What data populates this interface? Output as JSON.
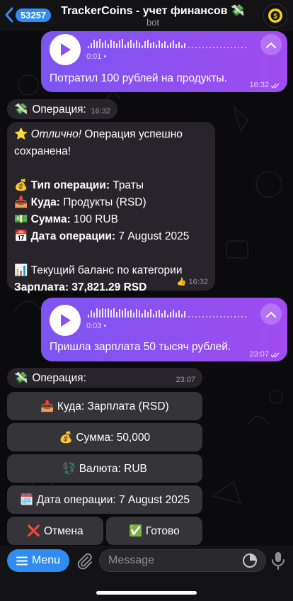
{
  "header": {
    "back_count": "53257",
    "title": "TrackerCoins - учет финансов 💸",
    "subtitle": "bot"
  },
  "messages": {
    "voice1": {
      "duration": "0:01",
      "transcript": "Потратил 100 рублей на продукты.",
      "time": "16:32"
    },
    "op1": {
      "label": "Операция:",
      "time": "16:32"
    },
    "result": {
      "line1_star": "⭐",
      "line1_em": "Отлично!",
      "line1_rest": " Операция успешно",
      "line2": "сохранена!",
      "type_icon": "💰",
      "type_key": "Тип операции:",
      "type_val": " Траты",
      "to_icon": "📥",
      "to_key": "Куда:",
      "to_val": " Продукты (RSD)",
      "sum_icon": "💵",
      "sum_key": "Сумма:",
      "sum_val": " 100 RUB",
      "date_icon": "📅",
      "date_key": "Дата операции:",
      "date_val": " 7 August 2025",
      "bal_icon": "📊",
      "bal_text": " Текущий баланс по категории",
      "bal_key": "Зарплата:",
      "bal_val": " 37,821.29 RSD",
      "stamp": "👍 16:32"
    },
    "voice2": {
      "duration": "0:03",
      "transcript": "Пришла зарплата 50 тысяч рублей.",
      "time": "23:07"
    },
    "op2": {
      "label": "Операция:",
      "time": "23:07"
    }
  },
  "keyboard": {
    "to": "📥 Куда: Зарплата (RSD)",
    "sum": "💰 Сумма: 50,000",
    "currency": "💱 Валюта: RUB",
    "date": "🗓️ Дата операции: 7 August 2025",
    "cancel": "❌ Отмена",
    "done": "✅ Готово"
  },
  "bottom": {
    "menu_label": "Menu",
    "placeholder": "Message"
  },
  "colors": {
    "accent": "#2f8cf0",
    "voice_gradient_start": "#7b55f2",
    "voice_gradient_end": "#a14cf0"
  },
  "icons": [
    "back-chevron-icon",
    "coin-bot-avatar-icon",
    "play-icon",
    "collapse-chevron-icon",
    "double-check-icon",
    "money-wings-icon",
    "menu-lines-icon",
    "paperclip-icon",
    "sticker-icon",
    "microphone-icon"
  ]
}
